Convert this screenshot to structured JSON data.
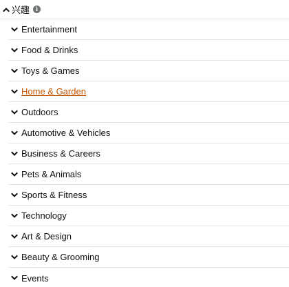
{
  "section": {
    "title": "兴趣",
    "info_icon": "info-icon",
    "expanded": true
  },
  "colors": {
    "text": "#0f1111",
    "hover_link": "#c45500",
    "divider": "#e3e6e6",
    "info_icon": "#6f7373"
  },
  "items": [
    {
      "label": "Entertainment"
    },
    {
      "label": "Food & Drinks"
    },
    {
      "label": "Toys & Games"
    },
    {
      "label": "Home & Garden",
      "state": "hover"
    },
    {
      "label": "Outdoors"
    },
    {
      "label": "Automotive & Vehicles"
    },
    {
      "label": "Business & Careers"
    },
    {
      "label": "Pets & Animals"
    },
    {
      "label": "Sports & Fitness"
    },
    {
      "label": "Technology"
    },
    {
      "label": "Art & Design"
    },
    {
      "label": "Beauty & Grooming"
    },
    {
      "label": "Events"
    }
  ]
}
